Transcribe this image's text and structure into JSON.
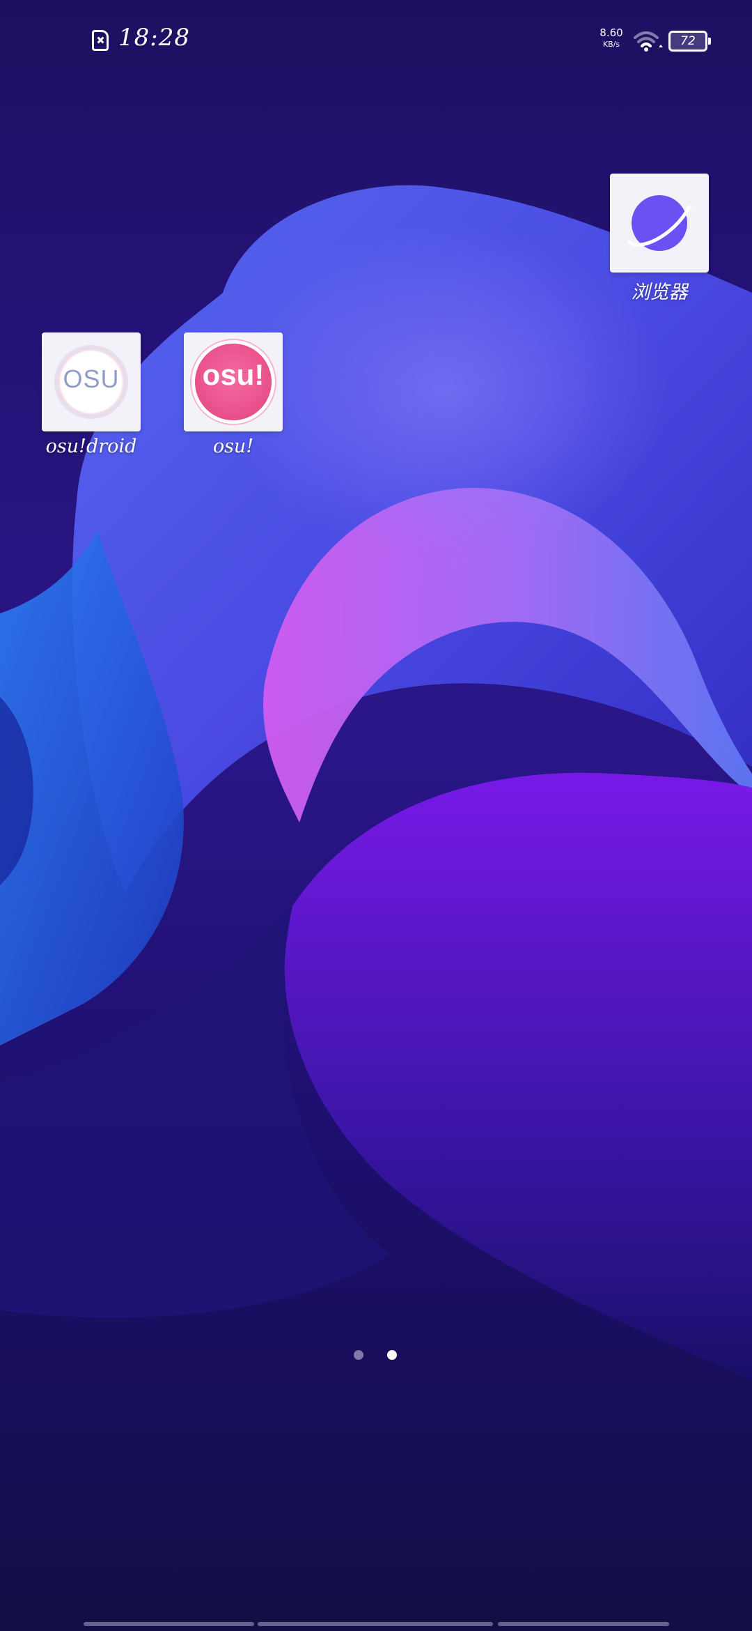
{
  "status_bar": {
    "time": "18:28",
    "net_speed_value": "8.60",
    "net_speed_unit": "KB/s",
    "battery_level": "72",
    "sim_icon": "no-sim-icon",
    "wifi_icon": "wifi-icon"
  },
  "apps": [
    {
      "label": "osu!droid",
      "icon": "osu-droid-icon"
    },
    {
      "label": "osu!",
      "icon": "osu-icon"
    },
    {
      "label": "浏览器",
      "icon": "planet-browser-icon"
    }
  ],
  "icon_text": {
    "osudroid": "OSU",
    "osu": "osu!"
  },
  "pager": {
    "page_count": 2,
    "current_page": 2
  },
  "colors": {
    "wallpaper_dark": "#12104a",
    "wallpaper_purple": "#7a19e6",
    "wallpaper_blue": "#3f5af0",
    "osu_pink": "#e84f8a",
    "browser_purple": "#6a52f2"
  }
}
